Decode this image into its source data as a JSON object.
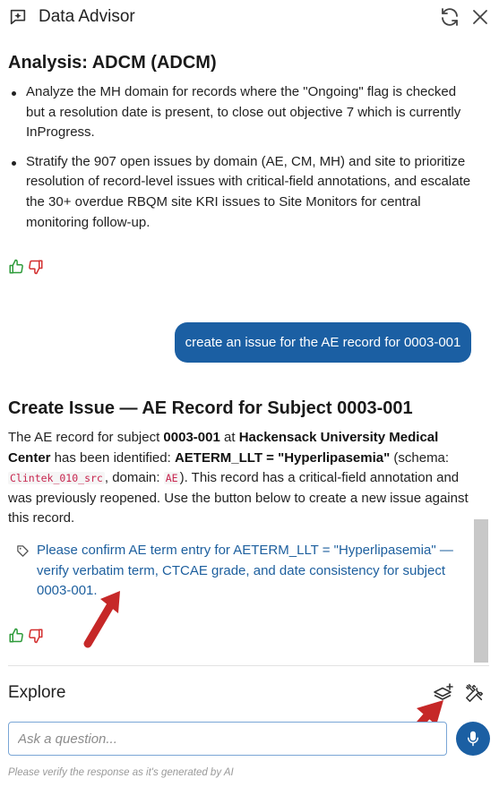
{
  "header": {
    "title": "Data Advisor",
    "logo_icon": "sparkle-chat-icon",
    "refresh_icon": "refresh-icon",
    "close_icon": "close-icon"
  },
  "analysis": {
    "heading": "Analysis: ADCM (ADCM)",
    "bullets": [
      "Analyze the MH domain for records where the \"Ongoing\" flag is checked but a resolution date is present, to close out objective 7 which is currently InProgress.",
      "Stratify the 907 open issues by domain (AE, CM, MH) and site to prioritize resolution of record-level issues with critical-field annotations, and escalate the 30+ overdue RBQM site KRI issues to Site Monitors for central monitoring follow-up."
    ]
  },
  "user_message": "create an issue for the AE record for 0003-001",
  "create_issue": {
    "heading": "Create Issue — AE Record for Subject 0003-001",
    "p1": "The AE record for subject ",
    "subject": "0003-001",
    "p2": " at ",
    "site": "Hackensack University Medical Center",
    "p3": " has been identified: ",
    "field": "AETERM_LLT = \"Hyperlipasemia\"",
    "p4": " (schema: ",
    "schema": "Clintek_010_src",
    "p5": ", domain: ",
    "domain": "AE",
    "p6": "). This record has a critical-field annotation and was previously reopened. Use the button below to create a new issue against this record.",
    "issue_link": "Please confirm AE term entry for AETERM_LLT = \"Hyperlipasemia\" — verify verbatim term, CTCAE grade, and date consistency for subject 0003-001."
  },
  "explore": {
    "label": "Explore",
    "layers_icon": "layers-add-icon",
    "tools_icon": "tools-icon"
  },
  "input": {
    "placeholder": "Ask a question...",
    "value": ""
  },
  "disclaimer": "Please verify the response as it's generated by AI",
  "colors": {
    "accent": "#1b5fa3",
    "link": "#1d5f9e",
    "like": "#2e9b3a",
    "dislike": "#d32f2f",
    "annotation_arrow": "#c62828"
  }
}
